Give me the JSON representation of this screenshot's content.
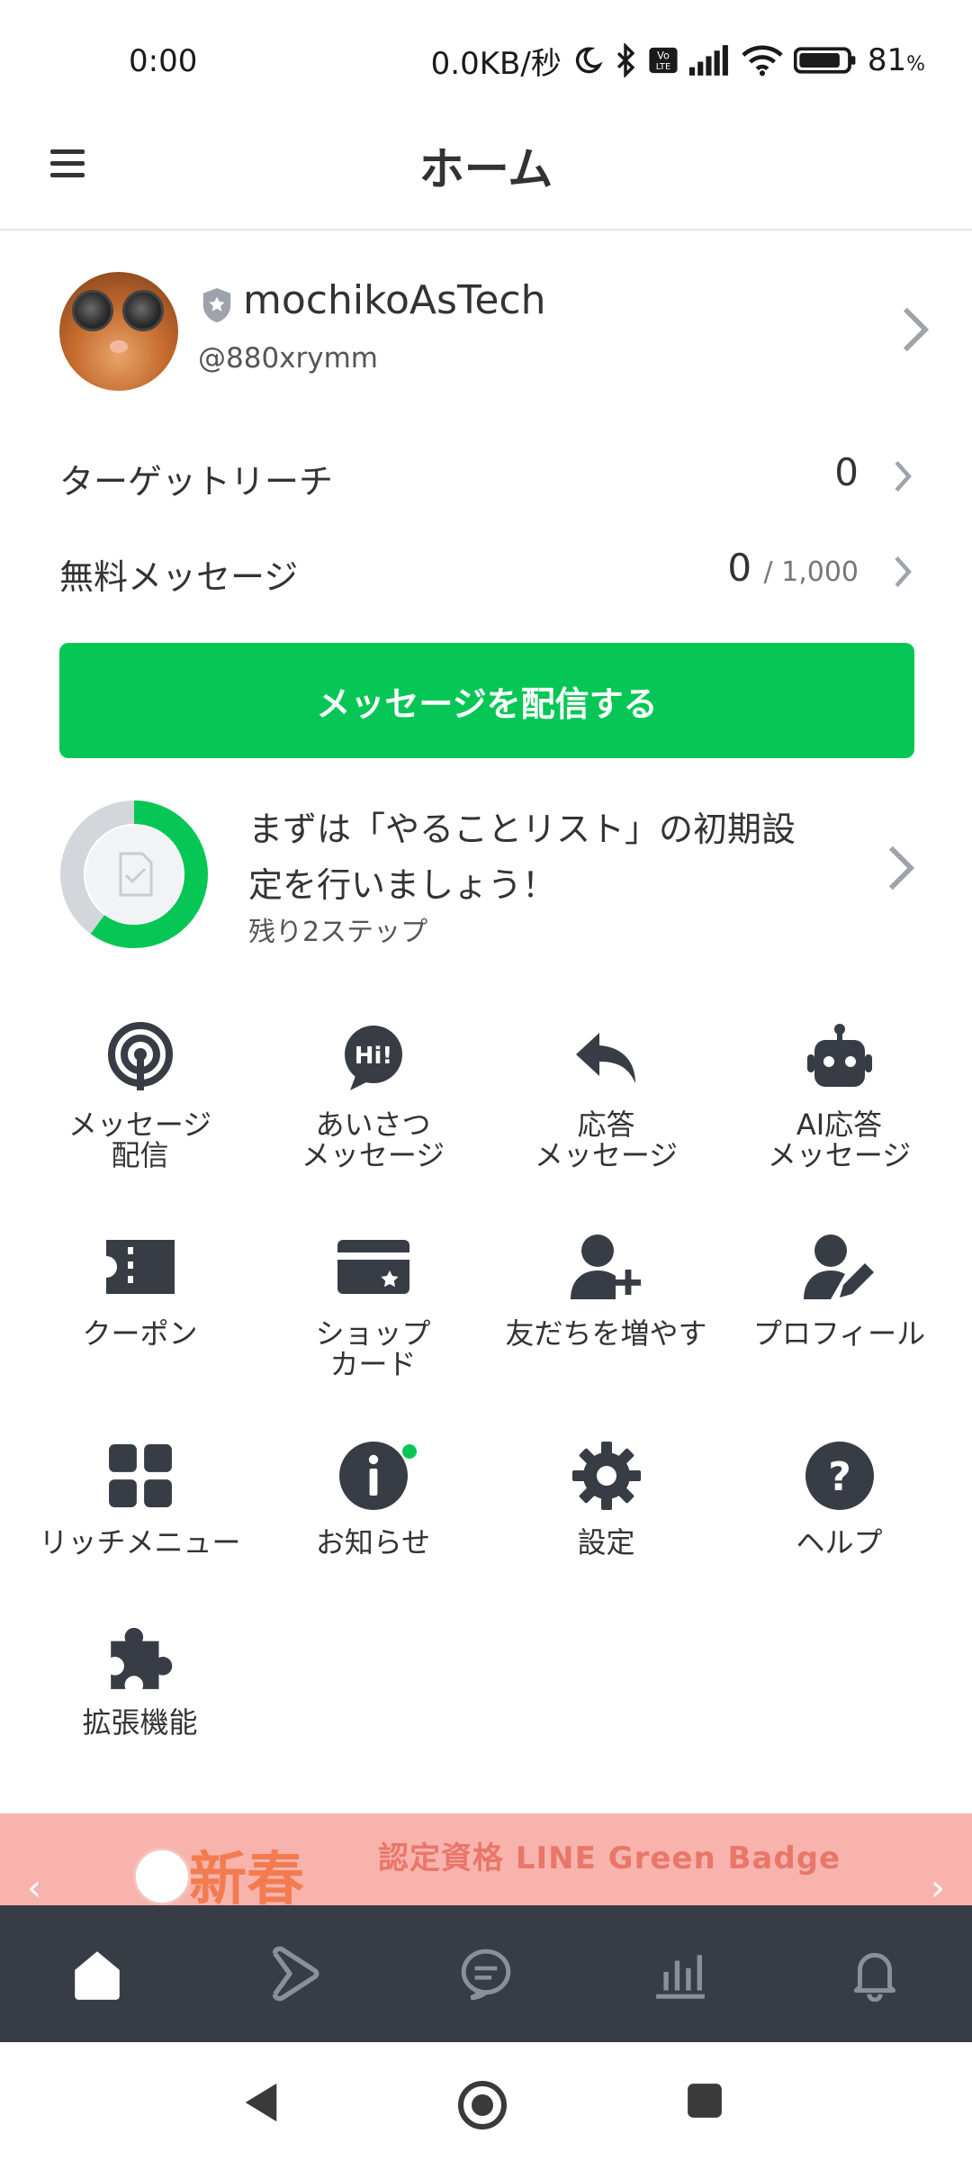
{
  "status_bar": {
    "time": "0:00",
    "network_speed": "0.0KB/秒",
    "battery": "81",
    "battery_unit": "%",
    "icons": [
      "moon-icon",
      "bluetooth-icon",
      "volte-icon",
      "signal-icon",
      "wifi-icon",
      "battery-icon"
    ]
  },
  "header": {
    "title": "ホーム",
    "menu_icon": "hamburger-icon"
  },
  "profile": {
    "name": "mochikoAsTech",
    "id": "@880xrymm",
    "badge_icon": "shield-star-icon"
  },
  "stats": {
    "target_reach_label": "ターゲットリーチ",
    "target_reach_value": "0",
    "free_messages_label": "無料メッセージ",
    "free_messages_value": "0",
    "free_messages_limit": "/ 1,000"
  },
  "primary_button": {
    "label": "メッセージを配信する"
  },
  "todo": {
    "title": "まずは「やることリスト」の初期設定を行いましょう！",
    "remaining": "残り2ステップ",
    "progress": 0.6
  },
  "menu": [
    {
      "label": "メッセージ\n配信",
      "icon": "broadcast-icon"
    },
    {
      "label": "あいさつ\nメッセージ",
      "icon": "hi-bubble-icon"
    },
    {
      "label": "応答\nメッセージ",
      "icon": "reply-icon"
    },
    {
      "label": "AI応答\nメッセージ",
      "icon": "robot-icon"
    },
    {
      "label": "クーポン",
      "icon": "coupon-icon"
    },
    {
      "label": "ショップ\nカード",
      "icon": "shop-card-icon"
    },
    {
      "label": "友だちを増やす",
      "icon": "add-friend-icon"
    },
    {
      "label": "プロフィール",
      "icon": "profile-edit-icon"
    },
    {
      "label": "リッチメニュー",
      "icon": "rich-menu-icon"
    },
    {
      "label": "お知らせ",
      "icon": "info-icon"
    },
    {
      "label": "設定",
      "icon": "gear-icon"
    },
    {
      "label": "ヘルプ",
      "icon": "help-icon"
    },
    {
      "label": "拡張機能",
      "icon": "puzzle-icon"
    }
  ],
  "banner": {
    "big_text": "新春",
    "text": "認定資格 LINE Green Badge"
  },
  "bottom_nav": [
    {
      "icon": "home-icon",
      "active": true
    },
    {
      "icon": "play-icon",
      "active": false
    },
    {
      "icon": "chat-icon",
      "active": false
    },
    {
      "icon": "analytics-icon",
      "active": false
    },
    {
      "icon": "bell-icon",
      "active": false
    }
  ],
  "colors": {
    "accent": "#06c755",
    "text": "#333333",
    "nav_bg": "#383c44",
    "banner_bg": "#f8b3ad"
  }
}
